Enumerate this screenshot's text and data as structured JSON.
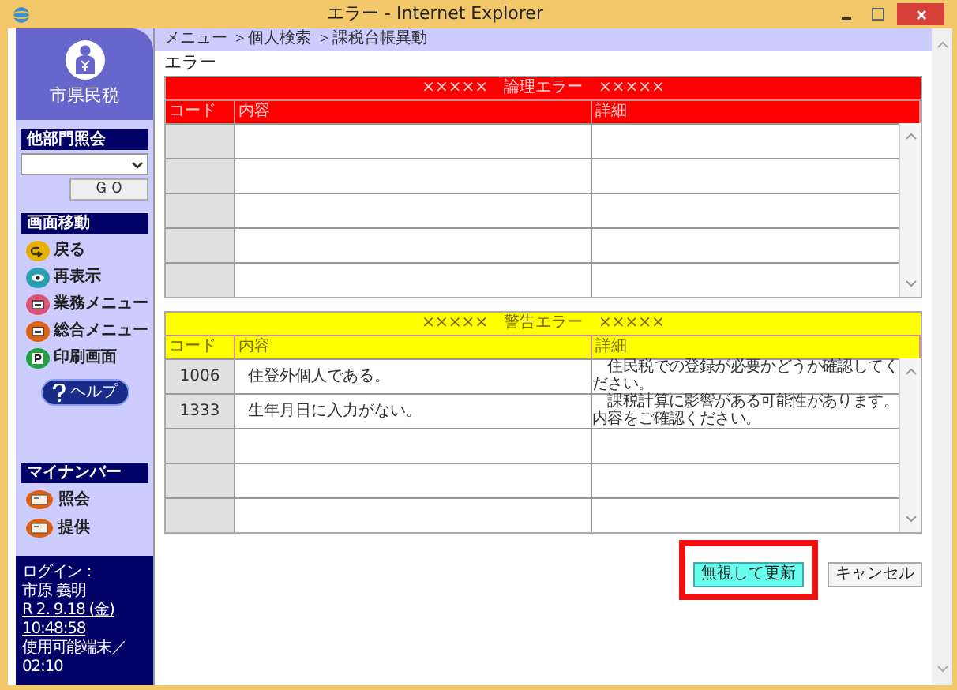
{
  "window": {
    "title": "エラー - Internet Explorer"
  },
  "sidebar": {
    "logo": "市県民税",
    "dept_inquiry": {
      "title": "他部門照会",
      "button": "ＧＯ"
    },
    "navigation": {
      "title": "画面移動",
      "items": [
        {
          "label": "戻る",
          "kind": "back",
          "color": "#e8b000"
        },
        {
          "label": "再表示",
          "kind": "refresh",
          "color": "#2a9fb0"
        },
        {
          "label": "業務メニュー",
          "kind": "menu",
          "color": "#e05070"
        },
        {
          "label": "総合メニュー",
          "kind": "menu",
          "color": "#e06010"
        },
        {
          "label": "印刷画面",
          "kind": "print",
          "color": "#20a040"
        }
      ],
      "help": "ヘルプ"
    },
    "my_number": {
      "title": "マイナンバー",
      "items": [
        {
          "label": "照会"
        },
        {
          "label": "提供"
        }
      ]
    },
    "login": [
      "ログイン：",
      "市原 義明",
      "R 2. 9.18 (金) 10:48:58",
      "使用可能端末／ 02:10"
    ]
  },
  "breadcrumb": "メニュー ＞個人検索 ＞課税台帳異動",
  "page_title": "エラー",
  "tables": [
    {
      "kind": "error",
      "title": "×××××　論理エラー　×××××",
      "columns": [
        "コード",
        "内容",
        "詳細"
      ]
    },
    {
      "kind": "warning",
      "title": "×××××　警告エラー　×××××",
      "columns": [
        "コード",
        "内容",
        "詳細"
      ],
      "rows": [
        {
          "code": "1006",
          "content": "住登外個人である。",
          "detail": "　住民税での登録が必要かどうか確認してください。"
        },
        {
          "code": "1333",
          "content": "生年月日に入力がない。",
          "detail": "　課税計算に影響がある可能性があります。内容をご確認ください。"
        }
      ]
    }
  ],
  "buttons": [
    {
      "label": "無視して更新",
      "kind": "primary",
      "highlighted": true
    },
    {
      "label": "キャンセル",
      "kind": "plain",
      "highlighted": false
    }
  ]
}
